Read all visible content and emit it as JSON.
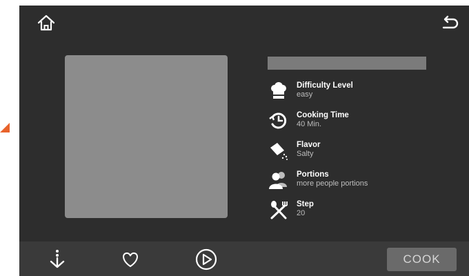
{
  "colors": {
    "screen_bg": "#2d2d2d",
    "bottom_bar_bg": "#3a3a3a",
    "image_placeholder": "#8c8c8c",
    "title_placeholder": "#7b7b7b",
    "cook_button_bg": "#6a6a6a",
    "accent_marker": "#e8632b"
  },
  "header": {
    "home_icon": "home-icon",
    "back_icon": "back-arrow-icon"
  },
  "recipe": {
    "info": [
      {
        "icon": "chef-hat-icon",
        "label": "Difficulty Level",
        "value": "easy"
      },
      {
        "icon": "clock-icon",
        "label": "Cooking Time",
        "value": "40 Min."
      },
      {
        "icon": "salt-shaker-icon",
        "label": "Flavor",
        "value": "Salty"
      },
      {
        "icon": "people-icon",
        "label": "Portions",
        "value": "more people portions"
      },
      {
        "icon": "fork-spoon-icon",
        "label": "Step",
        "value": "20"
      }
    ]
  },
  "bottom_bar": {
    "download_icon": "download-icon",
    "favorite_icon": "heart-icon",
    "play_icon": "play-icon",
    "cook_label": "COOK"
  }
}
